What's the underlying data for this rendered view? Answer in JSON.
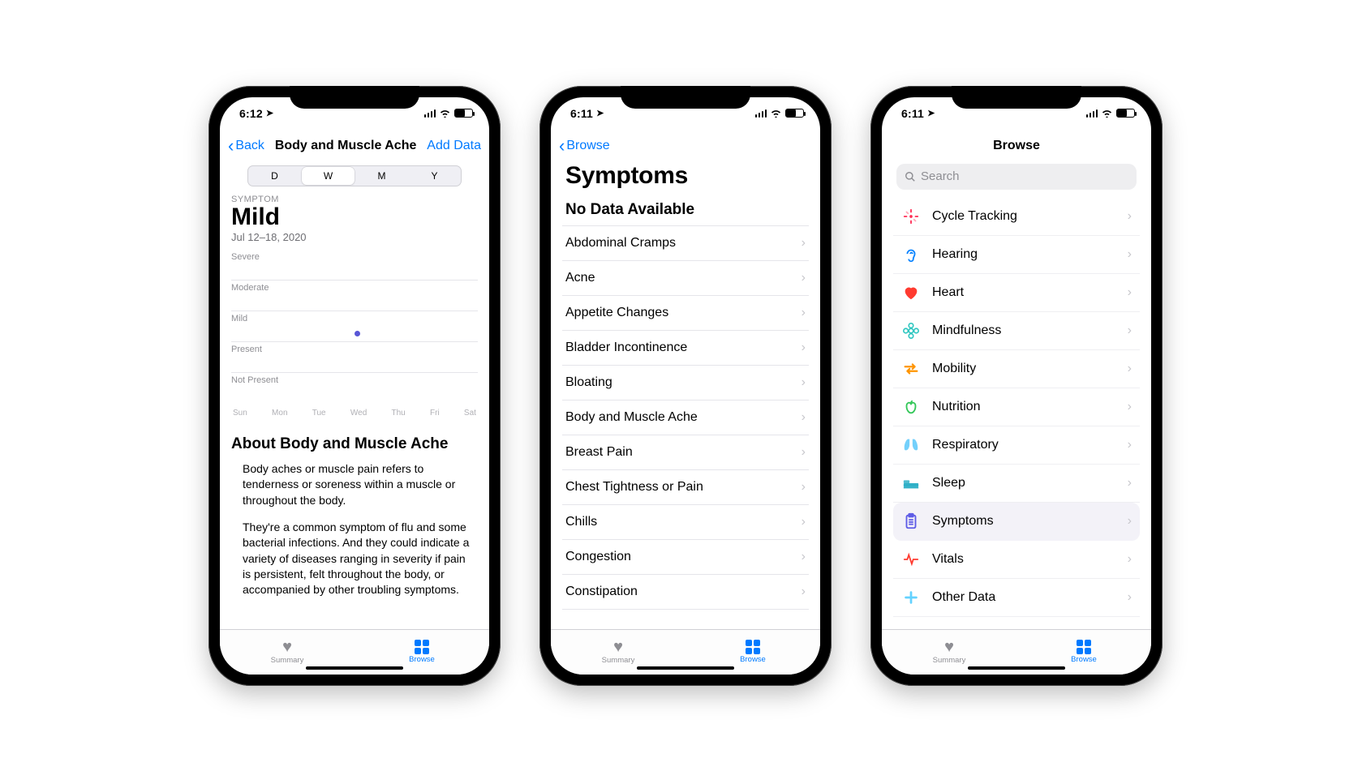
{
  "phone1": {
    "status_time": "6:12",
    "nav": {
      "back_label": "Back",
      "title": "Body and Muscle Ache",
      "action_label": "Add Data"
    },
    "segments": [
      "D",
      "W",
      "M",
      "Y"
    ],
    "segment_selected_index": 1,
    "symptom_caption": "SYMPTOM",
    "severity_value": "Mild",
    "date_range": "Jul 12–18, 2020",
    "about_heading": "About Body and Muscle Ache",
    "about_p1": "Body aches or muscle pain refers to tenderness or soreness within a muscle or throughout the body.",
    "about_p2": "They're a common symptom of flu and some bacterial infections. And they could indicate a variety of diseases ranging in severity if pain is persistent, felt throughout the body, or accompanied by other troubling symptoms."
  },
  "phone2": {
    "status_time": "6:11",
    "nav_back_label": "Browse",
    "title": "Symptoms",
    "section_header": "No Data Available",
    "items": [
      "Abdominal Cramps",
      "Acne",
      "Appetite Changes",
      "Bladder Incontinence",
      "Bloating",
      "Body and Muscle Ache",
      "Breast Pain",
      "Chest Tightness or Pain",
      "Chills",
      "Congestion",
      "Constipation"
    ]
  },
  "phone3": {
    "status_time": "6:11",
    "nav_title": "Browse",
    "search_placeholder": "Search",
    "categories": [
      {
        "label": "Cycle Tracking",
        "icon": "cycle",
        "color": "#ff2d55"
      },
      {
        "label": "Hearing",
        "icon": "ear",
        "color": "#0a84ff"
      },
      {
        "label": "Heart",
        "icon": "heart",
        "color": "#ff3b30"
      },
      {
        "label": "Mindfulness",
        "icon": "flower",
        "color": "#2ec6c0"
      },
      {
        "label": "Mobility",
        "icon": "arrows",
        "color": "#ff9500"
      },
      {
        "label": "Nutrition",
        "icon": "apple",
        "color": "#34c759"
      },
      {
        "label": "Respiratory",
        "icon": "lungs",
        "color": "#5ac8fa"
      },
      {
        "label": "Sleep",
        "icon": "bed",
        "color": "#30b0c7"
      },
      {
        "label": "Symptoms",
        "icon": "clip",
        "color": "#5e5ce6",
        "selected": true
      },
      {
        "label": "Vitals",
        "icon": "vitals",
        "color": "#ff3b30"
      },
      {
        "label": "Other Data",
        "icon": "plus",
        "color": "#64d2ff"
      }
    ]
  },
  "tabbar": {
    "summary_label": "Summary",
    "browse_label": "Browse"
  },
  "chart_data": {
    "type": "scatter",
    "title": "Body and Muscle Ache — weekly severity",
    "x_categories": [
      "Sun",
      "Mon",
      "Tue",
      "Wed",
      "Thu",
      "Fri",
      "Sat"
    ],
    "y_levels": [
      "Not Present",
      "Present",
      "Mild",
      "Moderate",
      "Severe"
    ],
    "data_points": [
      {
        "x": "Wed",
        "y": "Mild"
      }
    ],
    "date_range": "Jul 12–18, 2020"
  }
}
